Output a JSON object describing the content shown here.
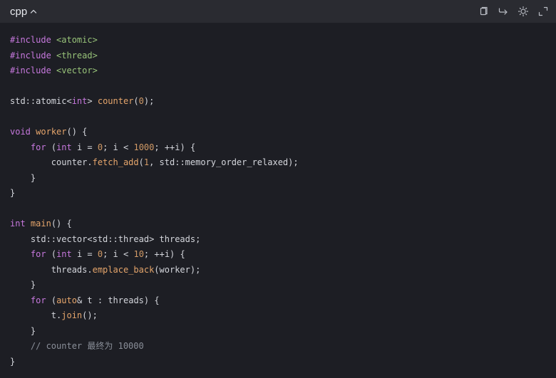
{
  "header": {
    "language": "cpp",
    "icons": [
      "copy-icon",
      "wrap-icon",
      "theme-icon",
      "expand-icon"
    ]
  },
  "code": {
    "include_kw": "#include",
    "h1": "<atomic>",
    "h2": "<thread>",
    "h3": "<vector>",
    "l5_a": "std::atomic<",
    "l5_b": "int",
    "l5_c": "> ",
    "l5_d": "counter",
    "l5_e": "(",
    "l5_f": "0",
    "l5_g": ");",
    "void": "void",
    "worker_fn": "worker",
    "paren_brace": "() {",
    "indent1": "    ",
    "indent2": "        ",
    "for": "for",
    "open_paren": "(",
    "int": "int",
    "i_eq": " i = ",
    "zero": "0",
    "i_lt": "; i < ",
    "n1000": "1000",
    "inc": "; ++i) {",
    "counter_dot": "counter.",
    "fetch_add": "fetch_add",
    "fetch_args_a": "(",
    "one": "1",
    "fetch_args_b": ", std::memory_order_relaxed);",
    "close_brace": "}",
    "main_fn": "main",
    "vec_line": "std::vector<std::thread> threads;",
    "n10": "10",
    "threads_dot": "threads.",
    "emplace_back": "emplace_back",
    "emplace_args": "(worker);",
    "auto": "auto",
    "range_rest": "& t : threads) {",
    "t_dot": "t.",
    "join": "join",
    "join_rest": "();",
    "comment": "// counter 最终为 10000"
  }
}
